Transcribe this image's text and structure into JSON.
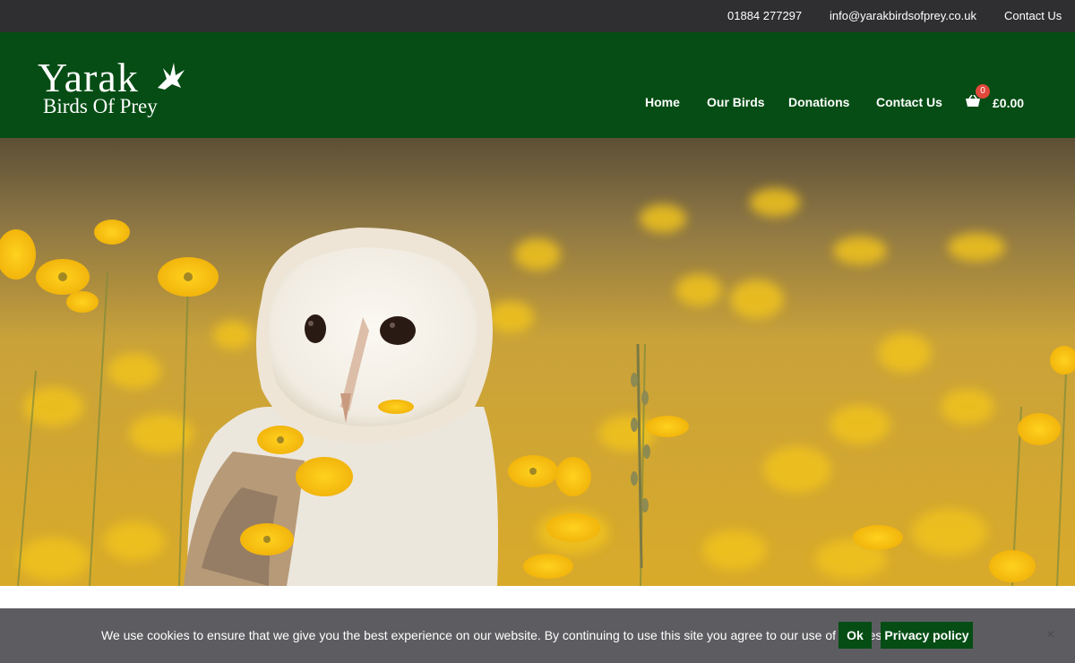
{
  "topbar": {
    "phone": "01884 277297",
    "email": "info@yarakbirdsofprey.co.uk",
    "contact": "Contact Us"
  },
  "logo": {
    "name": "Yarak",
    "subtitle": "Birds Of Prey"
  },
  "nav": {
    "items": [
      "Home",
      "Our Birds",
      "Donations",
      "Contact Us"
    ]
  },
  "cart": {
    "count": "0",
    "total": "£0.00"
  },
  "cookie": {
    "text": "We use cookies to ensure that we give you the best experience on our website. By continuing to use this site you agree to our use of cookies.",
    "ok": "Ok",
    "privacy": "Privacy policy",
    "close": "×"
  },
  "colors": {
    "topbar": "#2f2f31",
    "header": "#054d14",
    "cookie_bar": "#5d5d61",
    "button": "#054d14",
    "badge": "#e0483a"
  }
}
